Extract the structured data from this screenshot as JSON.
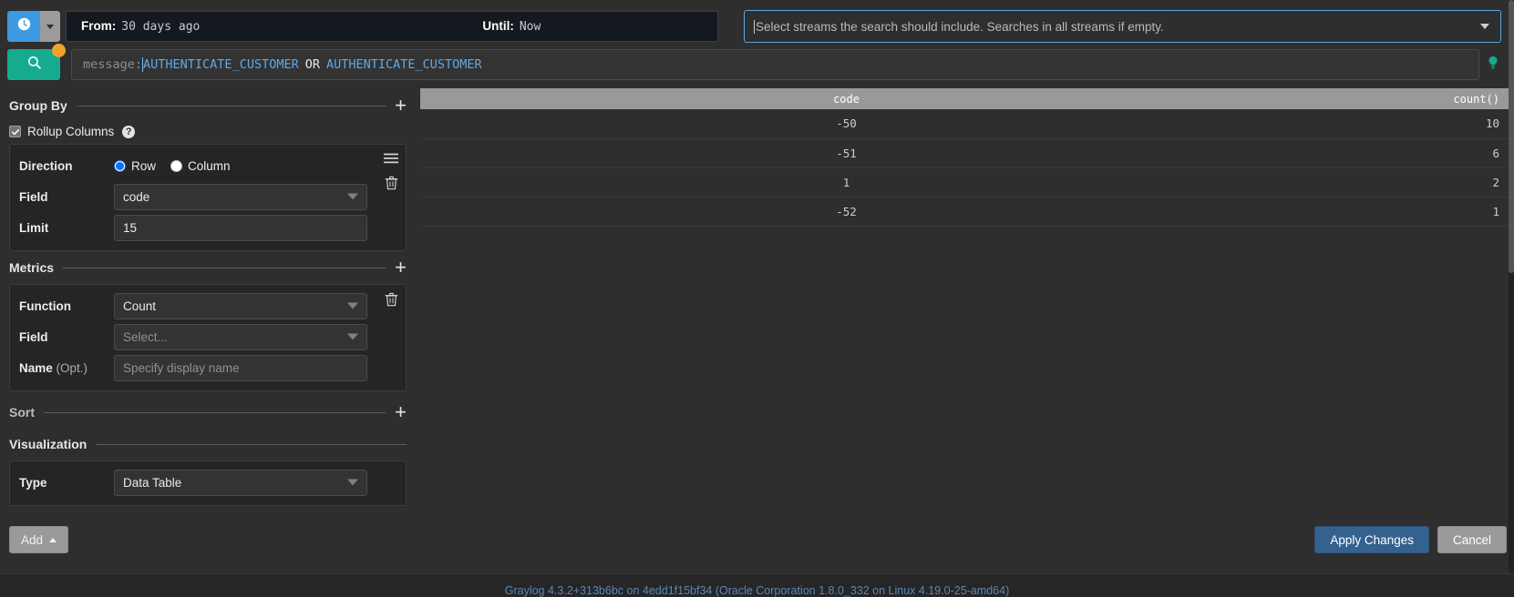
{
  "searchbar": {
    "time_icon": "clock-icon",
    "timerange": {
      "from_label": "From:",
      "from_value": "30 days ago",
      "until_label": "Until:",
      "until_value": "Now"
    },
    "streams": {
      "placeholder": "Select streams the search should include. Searches in all streams if empty."
    }
  },
  "query": {
    "search_icon": "magnifier-icon",
    "field_prefix": "message:",
    "value_1": "AUTHENTICATE_CUSTOMER",
    "operator": "OR",
    "value_2": "AUTHENTICATE_CUSTOMER",
    "hint_icon": "lightbulb-icon"
  },
  "config": {
    "group_by": {
      "title": "Group By",
      "add_label": "+",
      "rollup_label": "Rollup Columns",
      "rollup_checked": true,
      "help_glyph": "?",
      "direction_label": "Direction",
      "direction_options": [
        "Row",
        "Column"
      ],
      "direction_selected": "Row",
      "field_label": "Field",
      "field_value": "code",
      "limit_label": "Limit",
      "limit_value": "15"
    },
    "metrics": {
      "title": "Metrics",
      "add_label": "+",
      "function_label": "Function",
      "function_value": "Count",
      "field_label": "Field",
      "field_placeholder": "Select...",
      "name_label": "Name",
      "name_optional": " (Opt.)",
      "name_placeholder": "Specify display name"
    },
    "sort": {
      "title": "Sort",
      "add_label": "+"
    },
    "visualization": {
      "title": "Visualization",
      "type_label": "Type",
      "type_value": "Data Table"
    },
    "add_button": {
      "label": "Add"
    }
  },
  "results": {
    "columns": [
      "code",
      "count()"
    ],
    "rows": [
      {
        "code": "-50",
        "count": "10"
      },
      {
        "code": "-51",
        "count": "6"
      },
      {
        "code": "1",
        "count": "2"
      },
      {
        "code": "-52",
        "count": "1"
      }
    ]
  },
  "actions": {
    "apply_label": "Apply Changes",
    "cancel_label": "Cancel"
  },
  "footer": {
    "text": "Graylog 4.3.2+313b6bc on 4edd1f15bf34 (Oracle Corporation 1.8.0_332 on Linux 4.19.0-25-amd64)"
  },
  "colors": {
    "accent_blue": "#3e9ae0",
    "search_green": "#16ab8e",
    "dirty_orange": "#f0a22e",
    "primary_button": "#35618f",
    "query_value": "#5da9e9"
  }
}
